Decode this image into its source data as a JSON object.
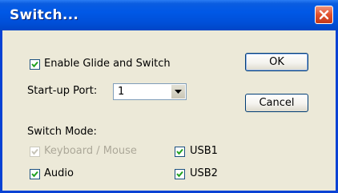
{
  "window": {
    "title": "Switch..."
  },
  "options": {
    "enable_glide": {
      "label": "Enable Glide and Switch",
      "checked": true
    },
    "startup_port": {
      "label": "Start-up Port:",
      "value": "1"
    }
  },
  "switch_mode": {
    "label": "Switch Mode:",
    "keyboard_mouse": {
      "label": "Keyboard / Mouse",
      "checked": true,
      "enabled": false
    },
    "audio": {
      "label": "Audio",
      "checked": true
    },
    "usb1": {
      "label": "USB1",
      "checked": true
    },
    "usb2": {
      "label": "USB2",
      "checked": true
    }
  },
  "buttons": {
    "ok": "OK",
    "cancel": "Cancel"
  },
  "colors": {
    "title_bar": "#0058e6",
    "close_button": "#e1502c",
    "dialog_background": "#ece9d8",
    "check_mark": "#21a121",
    "disabled_text": "#aca899"
  },
  "icons": {
    "close": "close-icon",
    "dropdown": "chevron-down-icon",
    "check": "check-icon"
  }
}
